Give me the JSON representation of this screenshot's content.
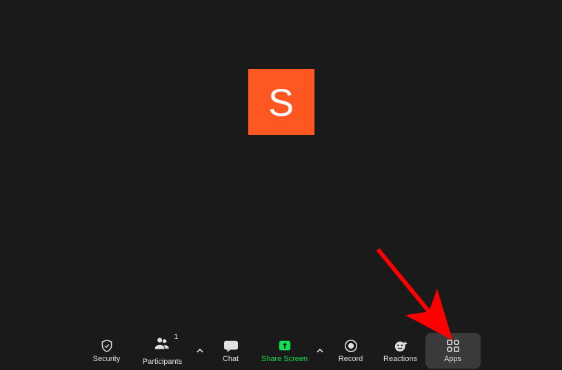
{
  "avatar": {
    "letter": "S",
    "bg_color": "#ff5722"
  },
  "toolbar": {
    "security": {
      "label": "Security"
    },
    "participants": {
      "label": "Participants",
      "count": "1"
    },
    "chat": {
      "label": "Chat"
    },
    "share_screen": {
      "label": "Share Screen"
    },
    "record": {
      "label": "Record"
    },
    "reactions": {
      "label": "Reactions"
    },
    "apps": {
      "label": "Apps"
    }
  },
  "annotation": {
    "arrow_color": "#ff0000"
  }
}
